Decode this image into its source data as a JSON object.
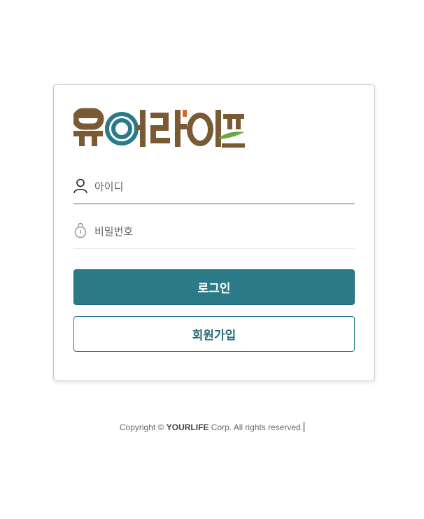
{
  "logo": {
    "text": "유어라이프",
    "brown": "#7a5a33",
    "teal": "#2a7b87",
    "green": "#6aa83f"
  },
  "login_form": {
    "id_placeholder": "아이디",
    "password_placeholder": "비밀번호",
    "id_icon": "user-icon",
    "password_icon": "lock-icon",
    "login_label": "로그인",
    "signup_label": "회원가입"
  },
  "footer": {
    "prefix": "Copyright ©",
    "company": "YOURLIFE",
    "suffix": "Corp. All rights reserved."
  },
  "colors": {
    "accent": "#2a7b87",
    "border": "#c9c9c9"
  }
}
